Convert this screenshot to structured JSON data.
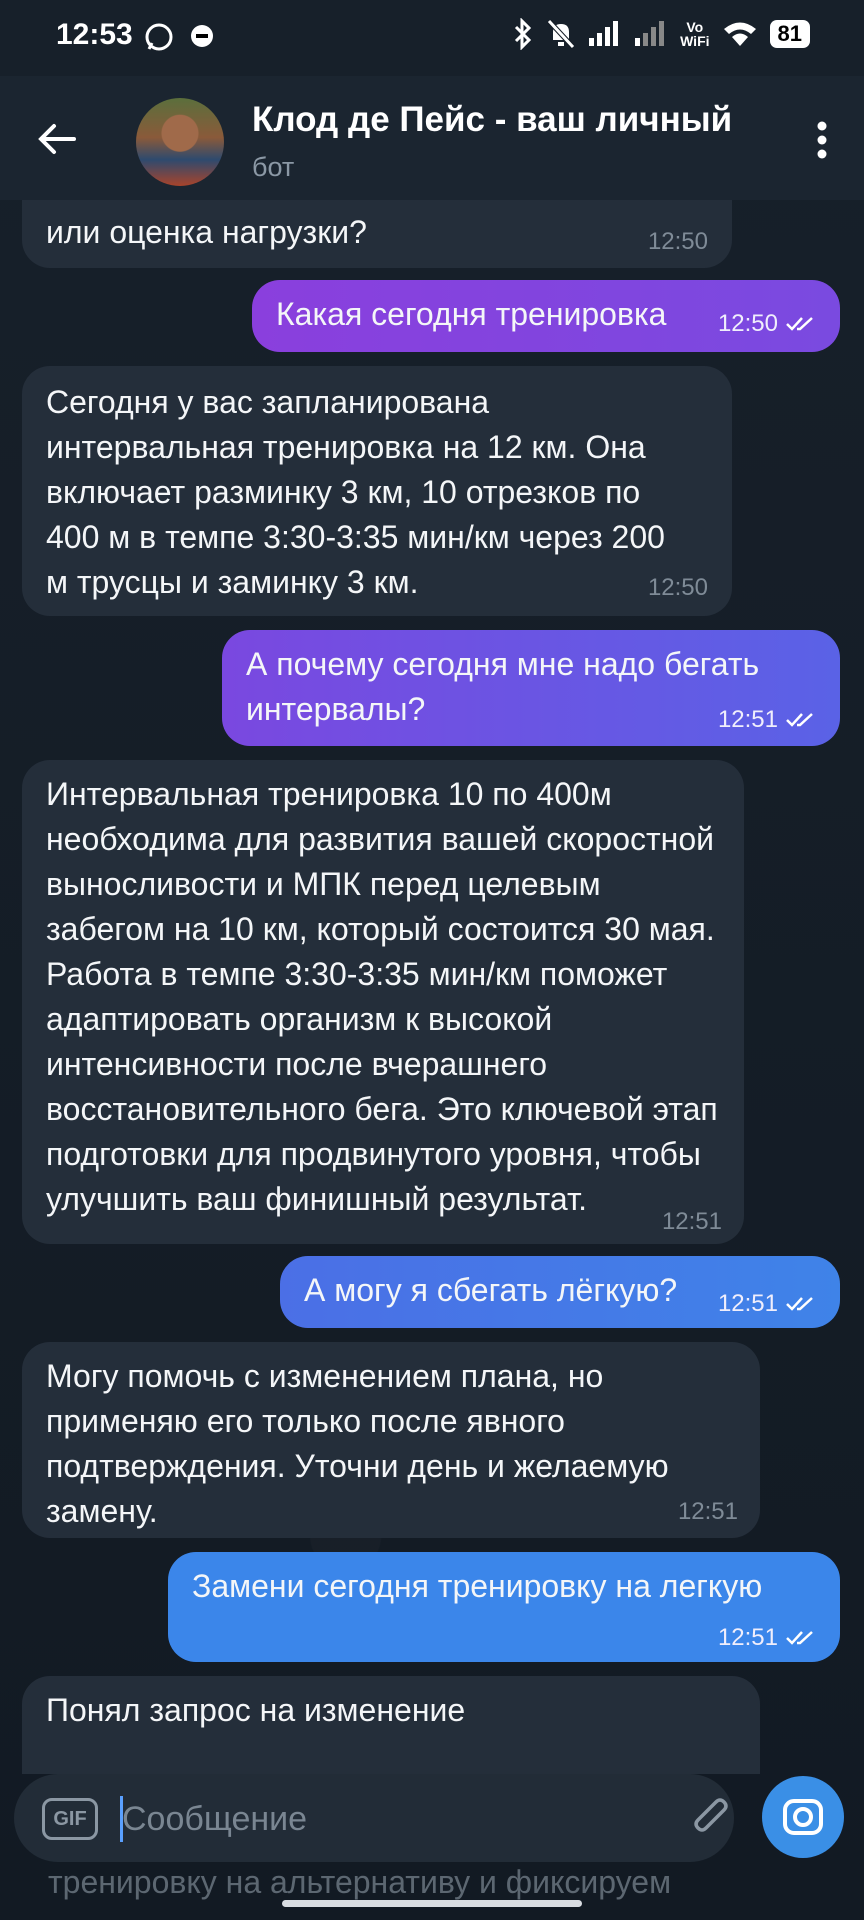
{
  "status_bar": {
    "time": "12:53",
    "vowifi_top": "Vo",
    "vowifi_bottom": "WiFi",
    "battery": "81"
  },
  "header": {
    "title": "Клод де Пейс - ваш личный",
    "subtitle": "бот"
  },
  "messages": [
    {
      "id": "m0",
      "direction": "in",
      "text": "или оценка нагрузки?",
      "time": "12:50"
    },
    {
      "id": "m1",
      "direction": "out",
      "text": "Какая сегодня тренировка",
      "time": "12:50"
    },
    {
      "id": "m2",
      "direction": "in",
      "text": "Сегодня у вас запланирована интервальная тренировка на 12 км. Она включает разминку 3 км, 10 отрезков по 400 м в темпе 3:30-3:35 мин/км через 200 м трусцы и заминку 3 км.",
      "time": "12:50"
    },
    {
      "id": "m3",
      "direction": "out",
      "text": "А почему сегодня мне надо бегать интервалы?",
      "time": "12:51"
    },
    {
      "id": "m4",
      "direction": "in",
      "text": "Интервальная тренировка 10 по 400м необходима для развития вашей скоростной выносливости и МПК перед целевым забегом на 10 км, который состоится 30 мая. Работа в темпе 3:30-3:35 мин/км поможет адаптировать организм к высокой интенсивности после вчерашнего восстановительного бега. Это ключевой этап подготовки для продвинутого уровня, чтобы улучшить ваш финишный результат.",
      "time": "12:51"
    },
    {
      "id": "m5",
      "direction": "out",
      "text": "А могу я сбегать лёгкую?",
      "time": "12:51"
    },
    {
      "id": "m6",
      "direction": "in",
      "text": "Могу помочь с изменением плана, но применяю его только после явного подтверждения. Уточни день и желаемую замену.",
      "time": "12:51"
    },
    {
      "id": "m7",
      "direction": "out",
      "text": "Замени сегодня тренировку на легкую",
      "time": "12:51"
    },
    {
      "id": "m8",
      "direction": "in",
      "text": "Понял запрос на изменение",
      "time": ""
    }
  ],
  "composer": {
    "gif_label": "GIF",
    "placeholder": "Сообщение",
    "below_text": "тренировку на альтернативу и фиксируем"
  },
  "colors": {
    "background": "#141c25",
    "incoming_bubble": "#242e3a",
    "outgoing_purple": "#8a3fdd",
    "outgoing_blue": "#3f83e8",
    "accent": "#3a8fe6"
  }
}
